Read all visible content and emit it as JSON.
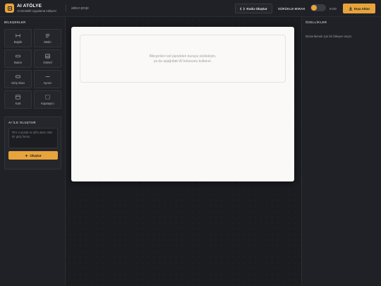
{
  "app": {
    "title": "AI ATÖLYE",
    "subtitle": "AI Destekli Uygulama Atölyesi",
    "project_name": "adsız-proje"
  },
  "toolbar": {
    "generate_code_label": "Kodu Oluştur",
    "mode_drag_label": "SÜRÜKLE-BIRAK",
    "mode_code_label": "KOD",
    "export_label": "Dışa Aktar"
  },
  "components_panel": {
    "title": "BİLEŞENLER",
    "items": [
      {
        "label": "Başlık",
        "icon": "heading-icon"
      },
      {
        "label": "Metin",
        "icon": "text-icon"
      },
      {
        "label": "Buton",
        "icon": "button-icon"
      },
      {
        "label": "Görsel",
        "icon": "image-icon"
      },
      {
        "label": "Giriş Alanı",
        "icon": "input-icon"
      },
      {
        "label": "Ayırıcı",
        "icon": "divider-icon"
      },
      {
        "label": "Kart",
        "icon": "card-icon"
      },
      {
        "label": "Kapsayıcı",
        "icon": "container-icon"
      }
    ]
  },
  "ai_panel": {
    "title": "AI İLE OLUŞTUR",
    "placeholder": "Örn: e-posta ve şifre alanı olan bir giriş formu",
    "generate_label": "Oluştur"
  },
  "canvas": {
    "empty_line1": "Bileşenleri sol panelden buraya sürükleyin,",
    "empty_line2": "ya da aşağıdaki AI kutusunu kullanın."
  },
  "properties_panel": {
    "title": "ÖZELLİKLER",
    "hint": "Düzenlemek için bir bileşen seçin."
  },
  "colors": {
    "accent": "#e7a43c",
    "background": "#1d1e22",
    "panel": "#202126",
    "canvas": "#faf9f7"
  }
}
